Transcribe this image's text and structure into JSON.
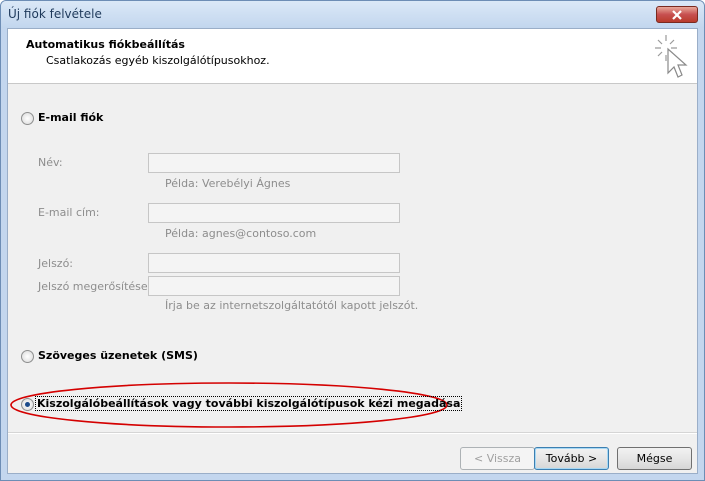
{
  "window": {
    "title": "Új fiók felvétele"
  },
  "header": {
    "title": "Automatikus fiókbeállítás",
    "subtitle": "Csatlakozás egyéb kiszolgálótípusokhoz."
  },
  "options": {
    "email": {
      "label": "E-mail fiók",
      "selected": false
    },
    "sms": {
      "label": "Szöveges üzenetek (SMS)",
      "selected": false
    },
    "manual": {
      "label": "Kiszolgálóbeállítások vagy további kiszolgálótípusok kézi megadása",
      "selected": true
    }
  },
  "email_form": {
    "name_label": "Név:",
    "name_value": "",
    "name_hint": "Példa: Verebélyi Ágnes",
    "email_label": "E-mail cím:",
    "email_value": "",
    "email_hint": "Példa: agnes@contoso.com",
    "password_label": "Jelszó:",
    "password_value": "",
    "confirm_label": "Jelszó megerősítése:",
    "confirm_value": "",
    "password_hint": "Írja be az internetszolgáltatótól kapott jelszót."
  },
  "buttons": {
    "back": "< Vissza",
    "next": "Tovább >",
    "cancel": "Mégse"
  },
  "colors": {
    "highlight_ellipse": "#d40000",
    "window_frame": "#c3d6ee"
  }
}
